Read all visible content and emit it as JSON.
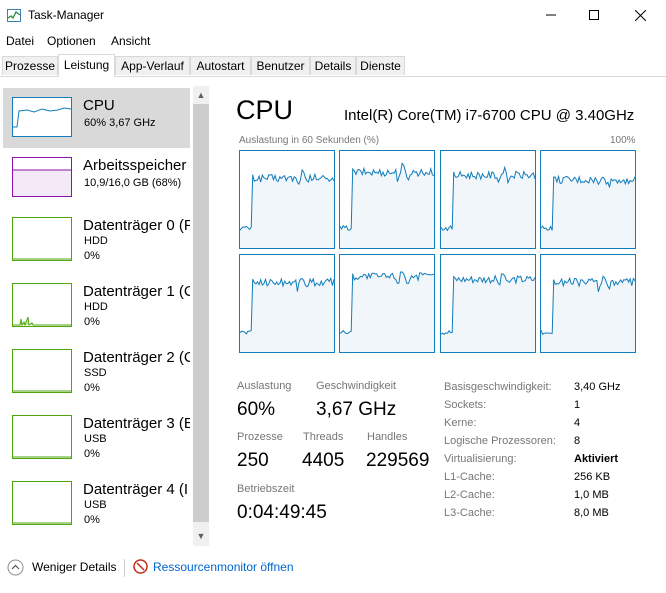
{
  "window": {
    "title": "Task-Manager"
  },
  "menu": [
    "Datei",
    "Optionen",
    "Ansicht"
  ],
  "tabs": [
    "Prozesse",
    "Leistung",
    "App-Verlauf",
    "Autostart",
    "Benutzer",
    "Details",
    "Dienste"
  ],
  "active_tab": "Leistung",
  "sidebar": [
    {
      "title": "CPU",
      "sub1": "60%  3,67 GHz",
      "sub2": "",
      "icon": "cpu-graph-icon",
      "color": "#117dbb",
      "selected": true
    },
    {
      "title": "Arbeitsspeicher",
      "sub1": "10,9/16,0 GB (68%)",
      "sub2": "",
      "icon": "memory-graph-icon",
      "color": "#8b12ae"
    },
    {
      "title": "Datenträger 0 (F",
      "sub1": "HDD",
      "sub2": "0%",
      "icon": "disk-graph-icon",
      "color": "#4da60c"
    },
    {
      "title": "Datenträger 1 (C",
      "sub1": "HDD",
      "sub2": "0%",
      "icon": "disk-graph-icon",
      "color": "#4da60c"
    },
    {
      "title": "Datenträger 2 (C",
      "sub1": "SSD",
      "sub2": "0%",
      "icon": "disk-graph-icon",
      "color": "#4da60c"
    },
    {
      "title": "Datenträger 3 (E",
      "sub1": "USB",
      "sub2": "0%",
      "icon": "disk-graph-icon",
      "color": "#4da60c"
    },
    {
      "title": "Datenträger 4 (I",
      "sub1": "USB",
      "sub2": "0%",
      "icon": "disk-graph-icon",
      "color": "#4da60c"
    }
  ],
  "cpu": {
    "title": "CPU",
    "model": "Intel(R) Core(TM) i7-6700 CPU @ 3.40GHz",
    "graph_caption": "Auslastung in 60 Sekunden (%)",
    "graph_max": "100%",
    "stats": {
      "auslastung_label": "Auslastung",
      "auslastung_value": "60%",
      "geschwindigkeit_label": "Geschwindigkeit",
      "geschwindigkeit_value": "3,67 GHz",
      "prozesse_label": "Prozesse",
      "prozesse_value": "250",
      "threads_label": "Threads",
      "threads_value": "4405",
      "handles_label": "Handles",
      "handles_value": "229569",
      "betriebszeit_label": "Betriebszeit",
      "betriebszeit_value": "0:04:49:45"
    },
    "details": [
      {
        "label": "Basisgeschwindigkeit:",
        "value": "3,40 GHz"
      },
      {
        "label": "Sockets:",
        "value": "1"
      },
      {
        "label": "Kerne:",
        "value": "4"
      },
      {
        "label": "Logische Prozessoren:",
        "value": "8"
      },
      {
        "label": "Virtualisierung:",
        "value": "Aktiviert",
        "bold": true
      },
      {
        "label": "L1-Cache:",
        "value": "256 KB"
      },
      {
        "label": "L2-Cache:",
        "value": "1,0 MB"
      },
      {
        "label": "L3-Cache:",
        "value": "8,0 MB"
      }
    ]
  },
  "footer": {
    "less_details": "Weniger Details",
    "resource_monitor": "Ressourcenmonitor öffnen"
  },
  "colors": {
    "cpu": "#117dbb",
    "cpu_fill": "#f1f6fa",
    "memory": "#8b12ae",
    "disk": "#4da60c"
  }
}
